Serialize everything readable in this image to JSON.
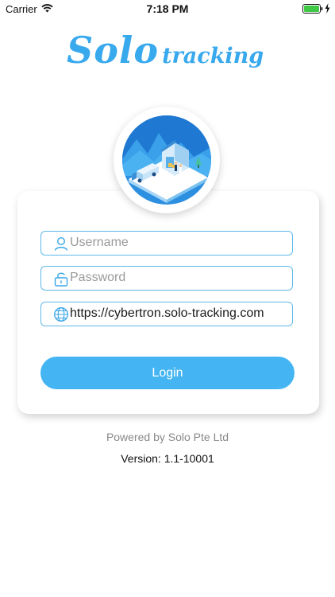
{
  "status_bar": {
    "carrier": "Carrier",
    "time": "7:18 PM",
    "wifi_icon": "wifi-icon",
    "battery_icon": "battery-full-icon",
    "charging_icon": "charging-bolt-icon"
  },
  "logo": {
    "part1": "Solo",
    "part2": "tracking"
  },
  "form": {
    "username": {
      "placeholder": "Username",
      "value": "",
      "icon": "user-icon"
    },
    "password": {
      "placeholder": "Password",
      "value": "",
      "icon": "unlock-icon"
    },
    "server": {
      "placeholder": "",
      "value": "https://cybertron.solo-tracking.com",
      "icon": "globe-icon"
    },
    "login_label": "Login"
  },
  "footer": {
    "powered_by": "Powered by Solo Pte Ltd",
    "version": "Version: 1.1-10001"
  },
  "colors": {
    "accent": "#39a9ee",
    "button": "#44b5f2",
    "field_border": "#5fb8ea",
    "muted_text": "#888888"
  }
}
